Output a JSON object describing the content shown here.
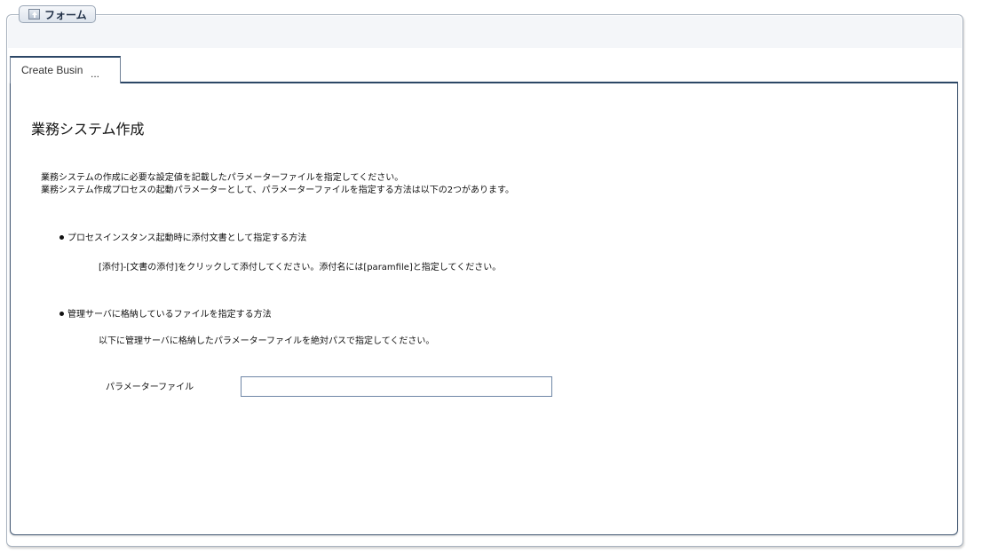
{
  "form": {
    "legend_label": "フォーム"
  },
  "tab": {
    "label": "Create Busin",
    "ellipsis": "..."
  },
  "content": {
    "title": "業務システム作成",
    "description_lines": [
      "業務システムの作成に必要な設定値を記載したパラメーターファイルを指定してください。",
      "業務システム作成プロセスの起動パラメーターとして、パラメーターファイルを指定する方法は以下の2つがあります。"
    ],
    "method1": {
      "heading": "プロセスインスタンス起動時に添付文書として指定する方法",
      "detail": "[添付]-[文書の添付]をクリックして添付してください。添付名には[paramfile]と指定してください。"
    },
    "method2": {
      "heading": "管理サーバに格納しているファイルを指定する方法",
      "detail": "以下に管理サーバに格納したパラメーターファイルを絶対パスで指定してください。"
    },
    "param_field": {
      "label": "パラメーターファイル",
      "value": ""
    }
  }
}
